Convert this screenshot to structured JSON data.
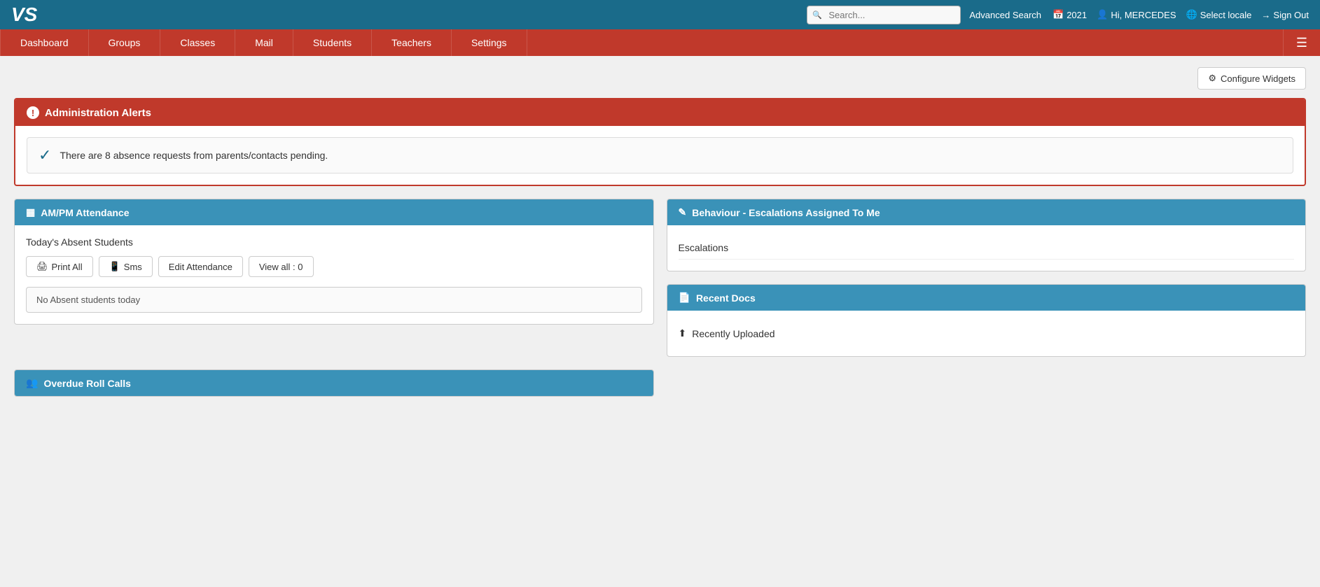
{
  "header": {
    "logo": "VS",
    "search_placeholder": "Search...",
    "advanced_search_label": "Advanced Search",
    "year": "2021",
    "user_greeting": "Hi, MERCEDES",
    "select_locale": "Select locale",
    "sign_out": "Sign Out"
  },
  "nav": {
    "items": [
      {
        "label": "Dashboard",
        "id": "dashboard"
      },
      {
        "label": "Groups",
        "id": "groups"
      },
      {
        "label": "Classes",
        "id": "classes"
      },
      {
        "label": "Mail",
        "id": "mail"
      },
      {
        "label": "Students",
        "id": "students"
      },
      {
        "label": "Teachers",
        "id": "teachers"
      },
      {
        "label": "Settings",
        "id": "settings"
      }
    ]
  },
  "configure_widgets_label": "Configure Widgets",
  "admin_alerts": {
    "title": "Administration Alerts",
    "alert_message": "There are 8 absence requests from parents/contacts pending."
  },
  "attendance_widget": {
    "title": "AM/PM Attendance",
    "today_label": "Today's Absent Students",
    "print_all": "Print All",
    "sms": "Sms",
    "edit_attendance": "Edit Attendance",
    "view_all": "View all : 0",
    "no_absent": "No Absent students today"
  },
  "behaviour_widget": {
    "title": "Behaviour - Escalations Assigned To Me",
    "escalations_label": "Escalations"
  },
  "recent_docs_widget": {
    "title": "Recent Docs",
    "recently_uploaded": "Recently Uploaded"
  },
  "overdue_widget": {
    "title": "Overdue Roll Calls"
  },
  "colors": {
    "nav_red": "#c0392b",
    "header_blue": "#1a6b8a",
    "widget_blue": "#3a92b8"
  }
}
